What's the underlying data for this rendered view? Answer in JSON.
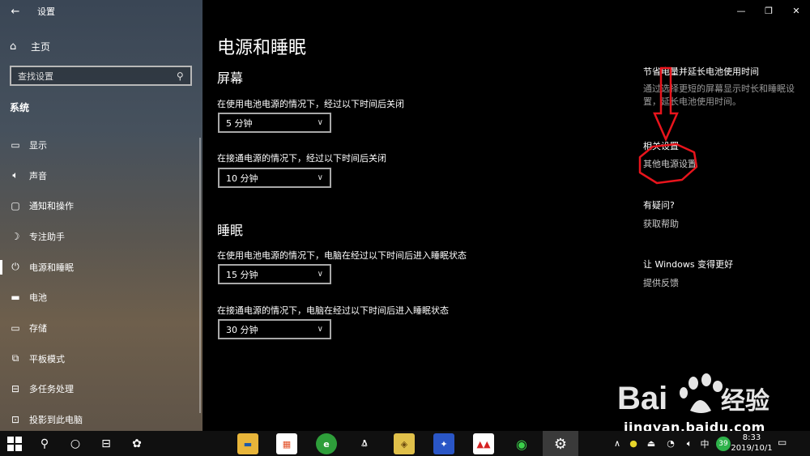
{
  "app": {
    "title": "设置"
  },
  "sidebar": {
    "home_label": "主页",
    "search_placeholder": "查找设置",
    "category": "系统",
    "items": [
      {
        "icon": "display-icon",
        "label": "显示"
      },
      {
        "icon": "speaker-icon",
        "label": "声音"
      },
      {
        "icon": "notification-icon",
        "label": "通知和操作"
      },
      {
        "icon": "moon-icon",
        "label": "专注助手"
      },
      {
        "icon": "power-icon",
        "label": "电源和睡眠",
        "selected": true
      },
      {
        "icon": "battery-icon",
        "label": "电池"
      },
      {
        "icon": "storage-icon",
        "label": "存储"
      },
      {
        "icon": "tablet-icon",
        "label": "平板模式"
      },
      {
        "icon": "multitask-icon",
        "label": "多任务处理"
      },
      {
        "icon": "project-icon",
        "label": "投影到此电脑"
      }
    ]
  },
  "main": {
    "title": "电源和睡眠",
    "screen": {
      "heading": "屏幕",
      "battery_label": "在使用电池电源的情况下，经过以下时间后关闭",
      "battery_value": "5 分钟",
      "plugged_label": "在接通电源的情况下，经过以下时间后关闭",
      "plugged_value": "10 分钟"
    },
    "sleep": {
      "heading": "睡眠",
      "battery_label": "在使用电池电源的情况下，电脑在经过以下时间后进入睡眠状态",
      "battery_value": "15 分钟",
      "plugged_label": "在接通电源的情况下，电脑在经过以下时间后进入睡眠状态",
      "plugged_value": "30 分钟"
    }
  },
  "right": {
    "save_heading": "节省电量并延长电池使用时间",
    "save_text": "通过选择更短的屏幕显示时长和睡眠设置，延长电池使用时间。",
    "related_heading": "相关设置",
    "related_link": "其他电源设置",
    "question_heading": "有疑问?",
    "help_link": "获取帮助",
    "improve_heading": "让 Windows 变得更好",
    "feedback_link": "提供反馈"
  },
  "watermark": {
    "url": "jingyan.baidu.com",
    "brand": "Bai",
    "brand2": "经验"
  },
  "taskbar": {
    "tray_badge": "39",
    "time": "8:33",
    "date": "2019/10/1",
    "apps": [
      "file-explorer",
      "store",
      "browser",
      "qq",
      "app-yellow",
      "app-blue",
      "app-red",
      "wechat",
      "settings"
    ]
  },
  "colors": {
    "annotation": "#e8141c",
    "accent_link": "#c8c8c8"
  }
}
